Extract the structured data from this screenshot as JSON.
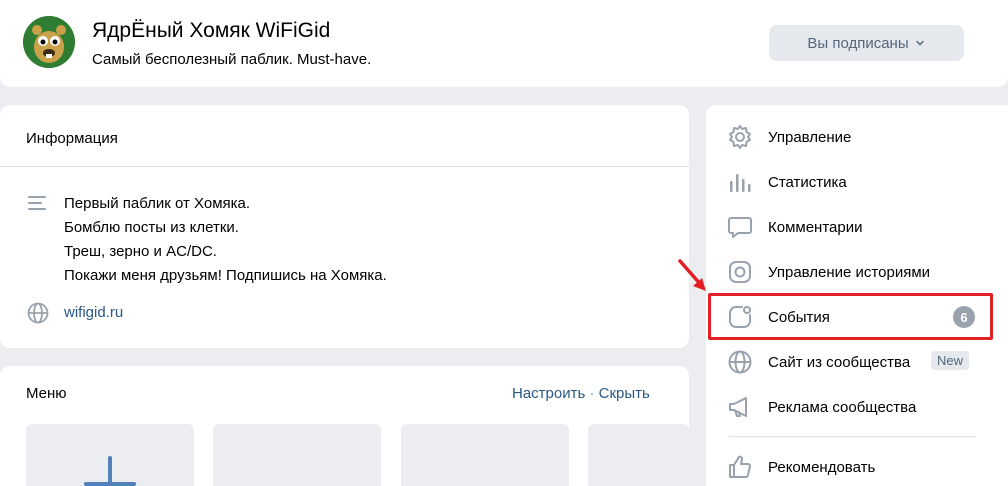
{
  "header": {
    "title": "ЯдрЁный Хомяк WiFiGid",
    "status": "Самый бесполезный паблик. Must-have.",
    "subscribe_button": "Вы подписаны",
    "subscribe_chevron": "chevron-down-icon"
  },
  "info": {
    "title": "Информация",
    "description": [
      "Первый паблик от Хомяка.",
      "Бомблю посты из клетки.",
      "Треш, зерно и AC/DC.",
      "Покажи меня друзьям! Подпишись на Хомяка."
    ],
    "link": "wifigid.ru"
  },
  "menu": {
    "title": "Меню",
    "configure": "Настроить",
    "separator": "·",
    "hide": "Скрыть"
  },
  "sidebar": {
    "items": [
      {
        "label": "Управление",
        "icon": "gear-icon"
      },
      {
        "label": "Статистика",
        "icon": "bar-chart-icon"
      },
      {
        "label": "Комментарии",
        "icon": "comment-icon"
      },
      {
        "label": "Управление историями",
        "icon": "stories-icon"
      },
      {
        "label": "События",
        "icon": "events-icon",
        "badge": "6"
      },
      {
        "label": "Сайт из сообщества",
        "icon": "globe-icon",
        "tag": "New"
      },
      {
        "label": "Реклама сообщества",
        "icon": "megaphone-icon"
      },
      {
        "label": "Рекомендовать",
        "icon": "thumbs-up-icon"
      }
    ]
  },
  "colors": {
    "link": "#2a5885",
    "icon": "#99a2ad",
    "highlight": "#e31e24",
    "background": "#ebedf0"
  }
}
